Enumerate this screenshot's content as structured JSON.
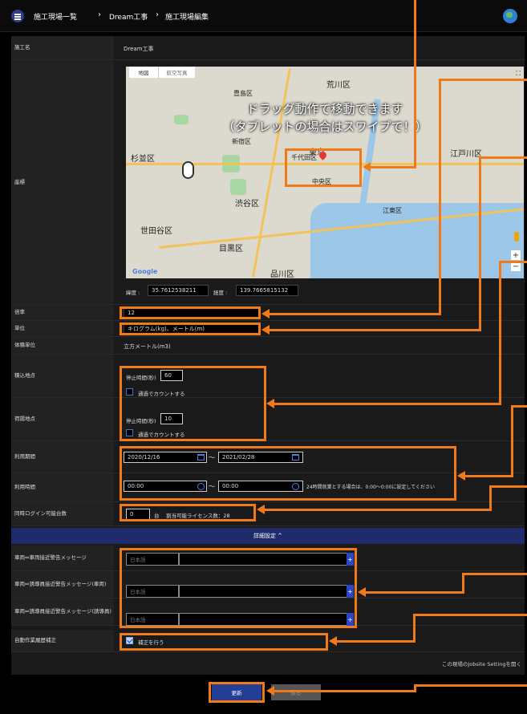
{
  "header": {
    "breadcrumb": [
      "施工現場一覧",
      "Dream工事",
      "施工現場編集"
    ],
    "separator": "›",
    "icons": [
      "menu-icon",
      "globe-icon"
    ]
  },
  "fields": {
    "site_name_label": "施工名",
    "site_name_value": "Dream工事",
    "coords_label": "座標",
    "lat_label": "緯度 :",
    "lat_value": "35.7612538211",
    "lng_label": "経度 :",
    "lng_value": "139.7665815132",
    "rate_label": "倍率",
    "rate_value": "12",
    "unit_label": "単位",
    "unit_value": "キログラム(kg)、メートル(m)",
    "volume_unit_label": "体積単位",
    "volume_unit_value": "立方メートル(m3)",
    "loading_label": "積込地点",
    "dumping_label": "荷揚地点",
    "stop_time_label": "停止時間(秒)",
    "loading_stop_value": "60",
    "dumping_stop_value": "10",
    "count_pass_label": "通過でカウントする",
    "period_label": "利用期間",
    "period_start": "2020/12/16",
    "period_end": "2021/02/28",
    "hours_label": "利用時間",
    "hours_start": "00:00",
    "hours_end": "00:00",
    "hours_note": "24時間就業とする場合は、0:00～0:00に設定してください",
    "tilde": "～",
    "login_label": "同時ログイン可能台数",
    "login_value": "0",
    "login_unit": "台",
    "license_note": "割当可能ライセンス数：28"
  },
  "map": {
    "tab_map": "地図",
    "tab_satellite": "航空写真",
    "overlay_line1": "ドラッグ動作で移動できます",
    "overlay_line2": "（タブレットの場合はスワイプで！）",
    "labels": [
      "荒川区",
      "豊島区",
      "杉並区",
      "新宿区",
      "千代田区",
      "東京",
      "中央区",
      "江戸川区",
      "渋谷区",
      "江東区",
      "世田谷区",
      "目黒区",
      "品川区"
    ],
    "zoom_in": "+",
    "zoom_out": "−",
    "google": "Google",
    "fullscreen": "⛶"
  },
  "details": {
    "section_label": "詳細設定 ^",
    "msg1_label": "車両⇔車両接近警告メッセージ",
    "msg2_label": "車両⇔誘導員接近警告メッセージ(車両)",
    "msg3_label": "車両⇔誘導員接近警告メッセージ(誘導員)",
    "lang_value": "日本語",
    "plus": "+",
    "auto_label": "自動作業履歴補正",
    "auto_check_label": "補正を行う",
    "jobsite_link": "この現場のJobsite Settingを開く"
  },
  "footer": {
    "update_button": "更新",
    "cancel_button": "戻る"
  },
  "colors": {
    "accent": "#2d3f86",
    "highlight": "#f07a1a",
    "section_bar": "#1f2a6b"
  }
}
